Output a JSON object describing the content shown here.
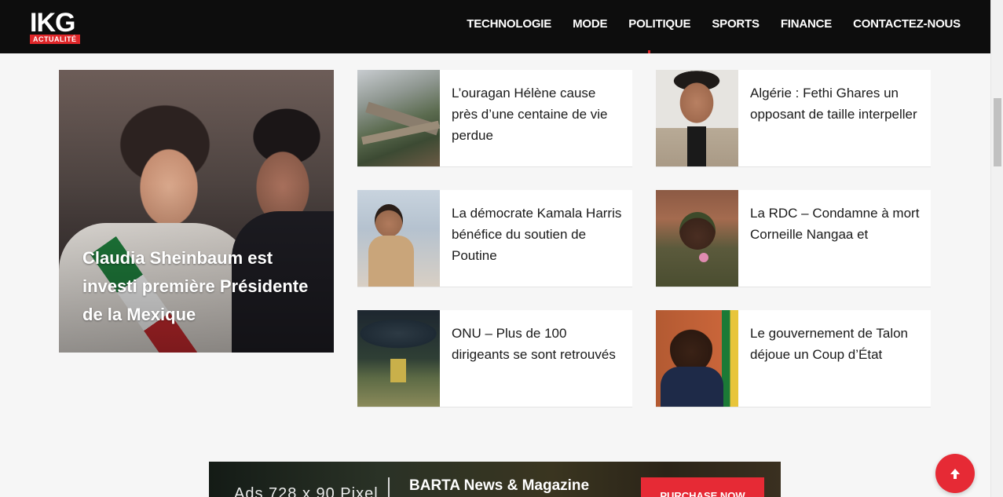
{
  "site": {
    "logo_text": "IKG",
    "logo_sub": "ACTUALITÉ"
  },
  "nav": {
    "items": [
      {
        "label": "TECHNOLOGIE"
      },
      {
        "label": "MODE"
      },
      {
        "label": "POLITIQUE"
      },
      {
        "label": "SPORTS"
      },
      {
        "label": "FINANCE"
      },
      {
        "label": "CONTACTEZ-NOUS"
      }
    ]
  },
  "featured": {
    "title": "Claudia Sheinbaum est investi première Présidente de la Mexique"
  },
  "articles": [
    {
      "title": "L’ouragan Hélène cause près d’une centaine de vie perdue"
    },
    {
      "title": "Algérie : Fethi Ghares un opposant de taille interpeller"
    },
    {
      "title": "La démocrate Kamala Harris bénéfice du soutien de Poutine"
    },
    {
      "title": "La RDC – Condamne à mort Corneille Nangaa et"
    },
    {
      "title": "ONU – Plus de 100 dirigeants se sont retrouvés"
    },
    {
      "title": "Le gouvernement de Talon déjoue un Coup d’État"
    }
  ],
  "ad": {
    "left_text": "Ads 728 x 90 Pixel",
    "title": "BARTA News & Magazine",
    "button": "PURCHASE NOW"
  },
  "colors": {
    "header_bg": "#0d0d0d",
    "accent": "#e62a35",
    "page_bg": "#f6f6f6"
  },
  "icons": {
    "back_to_top": "arrow-up-icon"
  }
}
